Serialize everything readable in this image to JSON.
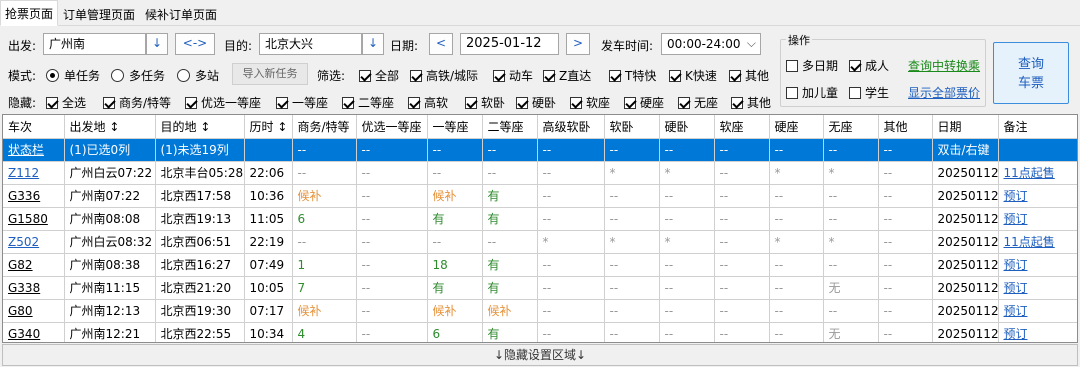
{
  "tabs": [
    "抢票页面",
    "订单管理页面",
    "候补订单页面"
  ],
  "search": {
    "from_label": "出发:",
    "from_value": "广州南",
    "swap_label": "<->",
    "to_label": "目的:",
    "to_value": "北京大兴",
    "date_label": "日期:",
    "date_value": "2025-01-12",
    "date_prev": "<",
    "date_next": ">",
    "time_label": "发车时间:",
    "time_value": "00:00-24:00",
    "dropdown_glyph": "↓"
  },
  "mode": {
    "label": "模式:",
    "options": [
      "单任务",
      "多任务",
      "多站"
    ],
    "selected": 0,
    "import_label": "导入新任务"
  },
  "filter": {
    "label": "筛选:",
    "items": [
      {
        "label": "全部",
        "checked": true
      },
      {
        "label": "高铁/城际",
        "checked": true
      },
      {
        "label": "动车",
        "checked": true
      },
      {
        "label": "Z直达",
        "checked": true
      },
      {
        "label": "T特快",
        "checked": true
      },
      {
        "label": "K快速",
        "checked": true
      },
      {
        "label": "其他",
        "checked": true
      }
    ]
  },
  "hide": {
    "label": "隐藏:",
    "items": [
      {
        "label": "全选",
        "checked": true
      },
      {
        "label": "商务/特等",
        "checked": true
      },
      {
        "label": "优选一等座",
        "checked": true
      },
      {
        "label": "一等座",
        "checked": true
      },
      {
        "label": "二等座",
        "checked": true
      },
      {
        "label": "高软",
        "checked": true
      },
      {
        "label": "软卧",
        "checked": true
      },
      {
        "label": "硬卧",
        "checked": true
      },
      {
        "label": "软座",
        "checked": true
      },
      {
        "label": "硬座",
        "checked": true
      },
      {
        "label": "无座",
        "checked": true
      },
      {
        "label": "其他",
        "checked": true
      }
    ]
  },
  "ops": {
    "title": "操作",
    "multi_date": {
      "label": "多日期",
      "checked": false
    },
    "adult": {
      "label": "成人",
      "checked": true
    },
    "transfer_link": "查询中转换乘",
    "child": {
      "label": "加儿童",
      "checked": false
    },
    "student": {
      "label": "学生",
      "checked": false
    },
    "all_price_link": "显示全部票价",
    "query_line1": "查询",
    "query_line2": "车票"
  },
  "table": {
    "columns": [
      "车次",
      "出发地 ↕",
      "目的地 ↕",
      "历时 ↕",
      "商务/特等",
      "优选一等座",
      "一等座",
      "二等座",
      "高级软卧",
      "软卧",
      "硬卧",
      "软座",
      "硬座",
      "无座",
      "其他",
      "日期",
      "备注"
    ],
    "status_row": [
      "状态栏",
      "(1)已选0列",
      "(1)未选19列",
      "",
      "--",
      "--",
      "--",
      "--",
      "--",
      "--",
      "--",
      "--",
      "--",
      "--",
      "--",
      "双击/右键",
      ""
    ],
    "rows": [
      {
        "train": "Z112",
        "from": "广州白云07:22",
        "to": "北京丰台05:28",
        "dur": "22:06",
        "seats": [
          "--",
          "--",
          "--",
          "--",
          "--",
          "*",
          "*",
          "--",
          "*",
          "*",
          "--"
        ],
        "date": "20250112",
        "note": "11点起售"
      },
      {
        "train": "G336",
        "from": "广州南07:22",
        "to": "北京西17:58",
        "dur": "10:36",
        "seats": [
          "候补",
          "--",
          "候补",
          "有",
          "--",
          "--",
          "--",
          "--",
          "--",
          "--",
          "--"
        ],
        "date": "20250112",
        "note": "预订"
      },
      {
        "train": "G1580",
        "from": "广州南08:08",
        "to": "北京西19:13",
        "dur": "11:05",
        "seats": [
          "6",
          "--",
          "有",
          "有",
          "--",
          "--",
          "--",
          "--",
          "--",
          "--",
          "--"
        ],
        "date": "20250112",
        "note": "预订"
      },
      {
        "train": "Z502",
        "from": "广州白云08:32",
        "to": "北京西06:51",
        "dur": "22:19",
        "seats": [
          "--",
          "--",
          "--",
          "--",
          "*",
          "*",
          "*",
          "--",
          "*",
          "*",
          "--"
        ],
        "date": "20250112",
        "note": "11点起售"
      },
      {
        "train": "G82",
        "from": "广州南08:38",
        "to": "北京西16:27",
        "dur": "07:49",
        "seats": [
          "1",
          "--",
          "18",
          "有",
          "--",
          "--",
          "--",
          "--",
          "--",
          "--",
          "--"
        ],
        "date": "20250112",
        "note": "预订"
      },
      {
        "train": "G338",
        "from": "广州南11:15",
        "to": "北京西21:20",
        "dur": "10:05",
        "seats": [
          "7",
          "--",
          "有",
          "有",
          "--",
          "--",
          "--",
          "--",
          "--",
          "无",
          "--"
        ],
        "date": "20250112",
        "note": "预订"
      },
      {
        "train": "G80",
        "from": "广州南12:13",
        "to": "北京西19:30",
        "dur": "07:17",
        "seats": [
          "候补",
          "--",
          "候补",
          "候补",
          "--",
          "--",
          "--",
          "--",
          "--",
          "--",
          "--"
        ],
        "date": "20250112",
        "note": "预订"
      },
      {
        "train": "G340",
        "from": "广州南12:21",
        "to": "北京西22:55",
        "dur": "10:34",
        "seats": [
          "4",
          "--",
          "6",
          "有",
          "--",
          "--",
          "--",
          "--",
          "--",
          "无",
          "--"
        ],
        "date": "20250112",
        "note": "预订"
      }
    ]
  },
  "bottom_bar": "↓隐藏设置区域↓",
  "colors": {
    "accent": "#0078d7",
    "link": "#1f5fbf",
    "waitlist": "#e69138",
    "available": "#2e8b2e",
    "green_link": "#1a8a1a"
  }
}
